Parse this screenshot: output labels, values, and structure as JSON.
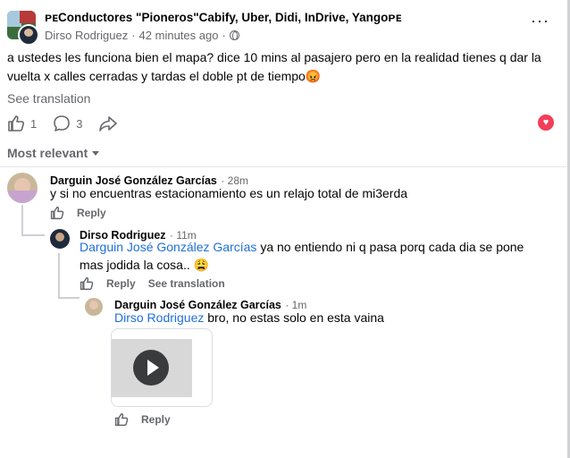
{
  "post": {
    "group_name": "ᴘᴇConductores \"Pioneros\"Cabify, Uber, Didi, InDrive, Yangoᴘᴇ",
    "author": "Dirso Rodriguez",
    "time": "42 minutes ago",
    "separator": "·",
    "text": "a ustedes les funciona bien el mapa? dice 10 mins al pasajero pero en la realidad tienes q dar la vuelta x calles cerradas y tardas el doble pt de tiempo😡",
    "see_translation": "See translation",
    "like_count": "1",
    "comment_count": "3",
    "more": "···"
  },
  "sort": {
    "label": "Most relevant"
  },
  "comments": [
    {
      "author": "Darguin José González Garcías",
      "time": "· 28m",
      "text": "y si no encuentras estacionamiento es un relajo total de mi3erda",
      "reply": "Reply"
    },
    {
      "author": "Dirso Rodriguez",
      "time": "· 11m",
      "mention": "Darguin José González Garcías",
      "text_line1": " ya no entiendo ni q pasa porq cada dia se pone",
      "text_line2": "mas jodida la cosa.. 😩",
      "reply": "Reply",
      "see_translation": "See translation"
    },
    {
      "author": "Darguin José González Garcías",
      "time": "· 1m",
      "mention": "Dirso Rodriguez",
      "text": " bro, no estas solo en esta vaina",
      "reply": "Reply"
    }
  ],
  "colors": {
    "link": "#216fdb",
    "muted": "#65676b",
    "love": "#f33e58"
  },
  "icons": [
    "globe-icon",
    "like-icon",
    "comment-icon",
    "share-icon",
    "love-reaction-icon",
    "play-icon",
    "chevron-down-icon"
  ]
}
